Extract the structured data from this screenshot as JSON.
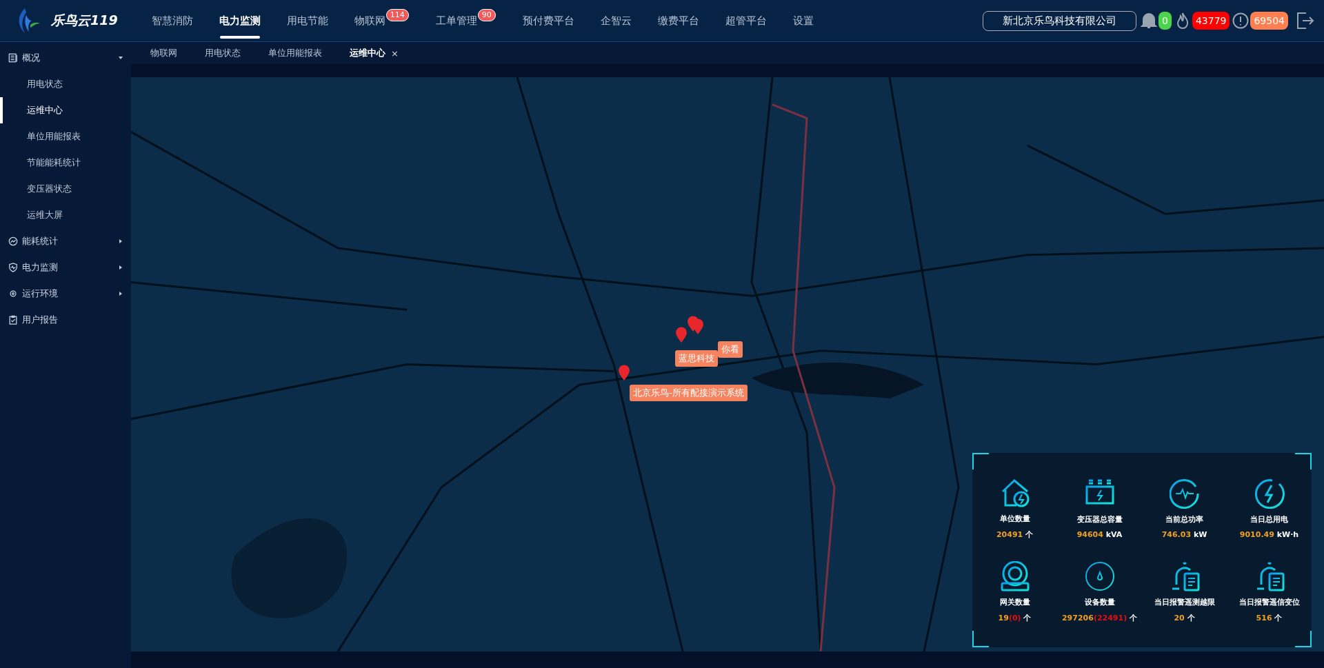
{
  "logo": {
    "text": "乐鸟云119"
  },
  "nav": [
    {
      "label": "智慧消防",
      "selected": false
    },
    {
      "label": "电力监测",
      "selected": true
    },
    {
      "label": "用电节能",
      "selected": false
    },
    {
      "label": "物联网",
      "selected": false,
      "badge": "114"
    },
    {
      "label": "工单管理",
      "selected": false,
      "badge": "90"
    },
    {
      "label": "预付费平台",
      "selected": false
    },
    {
      "label": "企智云",
      "selected": false
    },
    {
      "label": "缴费平台",
      "selected": false
    },
    {
      "label": "超管平台",
      "selected": false
    },
    {
      "label": "设置",
      "selected": false
    }
  ],
  "company": "新北京乐鸟科技有限公司",
  "alerts": [
    {
      "kind": "bell",
      "count": "0",
      "color": "#4cd44c"
    },
    {
      "kind": "fire",
      "count": "43779",
      "color": "#ff0000"
    },
    {
      "kind": "warning",
      "count": "69504",
      "color": "#ff7f50"
    }
  ],
  "sidebar": [
    {
      "label": "概况",
      "expanded": true,
      "children": [
        {
          "label": "用电状态",
          "selected": false
        },
        {
          "label": "运维中心",
          "selected": true
        },
        {
          "label": "单位用能报表",
          "selected": false
        },
        {
          "label": "节能能耗统计",
          "selected": false
        },
        {
          "label": "变压器状态",
          "selected": false
        },
        {
          "label": "运维大屏",
          "selected": false
        }
      ]
    },
    {
      "label": "能耗统计",
      "expanded": false
    },
    {
      "label": "电力监测",
      "expanded": false
    },
    {
      "label": "运行环境",
      "expanded": false
    },
    {
      "label": "用户报告"
    }
  ],
  "tabs": [
    {
      "label": "物联网",
      "selected": false
    },
    {
      "label": "用电状态",
      "selected": false
    },
    {
      "label": "单位用能报表",
      "selected": false
    },
    {
      "label": "运维中心",
      "selected": true
    }
  ],
  "close_tab_symbol": "×",
  "marker_labels": [
    "你看",
    "蓝思科技",
    "北京乐鸟-所有配接演示系统"
  ],
  "stats": [
    {
      "label": "单位数量",
      "value": "20491",
      "unit": "个"
    },
    {
      "label": "变压器总容量",
      "value": "94604",
      "unit": "kVA"
    },
    {
      "label": "当前总功率",
      "value": "746.03",
      "unit": "kW"
    },
    {
      "label": "当日总用电",
      "value": "9010.49",
      "unit": "kW·h"
    },
    {
      "label": "网关数量",
      "value": "19",
      "extra": "(0)",
      "unit": "个"
    },
    {
      "label": "设备数量",
      "value": "297206",
      "extra": "(22491)",
      "unit": "个"
    },
    {
      "label": "当日报警遥测越限",
      "value": "20",
      "unit": "个"
    },
    {
      "label": "当日报警遥信变位",
      "value": "516",
      "unit": "个"
    }
  ]
}
